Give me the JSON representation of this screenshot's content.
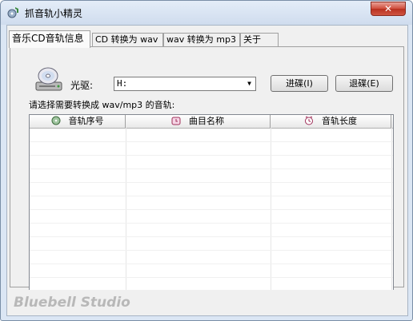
{
  "window": {
    "title": "抓音轨小精灵",
    "close_glyph": "✕"
  },
  "tabs": [
    {
      "label": "音乐CD音轨信息"
    },
    {
      "label": "CD 转换为 wav"
    },
    {
      "label": "wav 转换为 mp3"
    },
    {
      "label": "关于"
    }
  ],
  "drive": {
    "label": "光驱:",
    "value": "H:"
  },
  "buttons": {
    "load": "进碟(I)",
    "eject": "退碟(E)"
  },
  "prompt": "请选择需要转换成 wav/mp3 的音轨:",
  "table": {
    "columns": [
      {
        "label": "音轨序号",
        "icon": "cd-icon"
      },
      {
        "label": "曲目名称",
        "icon": "alarm-clock-icon"
      },
      {
        "label": "音轨长度",
        "icon": "clock-icon"
      }
    ],
    "rows": []
  },
  "status": {
    "brand": "Bluebell Studio"
  },
  "colors": {
    "title_bar": "#dbe6f4",
    "close_button": "#c94434",
    "brand_text": "#b8b8b8"
  }
}
